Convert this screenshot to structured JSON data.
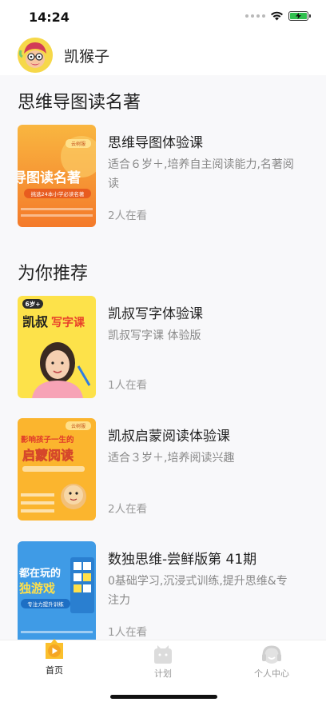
{
  "status_bar": {
    "time": "14:24"
  },
  "header": {
    "username": "凯猴子"
  },
  "sections": [
    {
      "title": "思维导图读名著"
    },
    {
      "title": "为你推荐"
    }
  ],
  "courses": [
    {
      "title": "思维导图体验课",
      "desc": "适合６岁＋,培养自主阅读能力,名著阅读",
      "count": "2人在看",
      "thumb": {
        "tag": "云树服",
        "headline": "导图读名著",
        "sub": "挑选24本小学必读名著"
      }
    },
    {
      "title": "凯叔写字体验课",
      "desc": "凯叔写字课 体验版",
      "count": "1人在看",
      "thumb": {
        "tag": "6岁+",
        "headline": "凯叔",
        "headline_accent": "写字课"
      }
    },
    {
      "title": "凯叔启蒙阅读体验课",
      "desc": "适合３岁＋,培养阅读兴趣",
      "count": "2人在看",
      "thumb": {
        "tag": "云树服",
        "headline": "影响孩子一生的",
        "headline2": "启蒙阅读"
      }
    },
    {
      "title": "数独思维-尝鲜版第 41期",
      "desc": "0基础学习,沉浸式训练,提升思维&专注力",
      "count": "1人在看",
      "thumb": {
        "headline": "都在玩的",
        "headline2": "独游戏",
        "sub": "专注力提升训练"
      }
    }
  ],
  "tabbar": {
    "tabs": [
      {
        "label": "首页",
        "active": true
      },
      {
        "label": "计划",
        "active": false
      },
      {
        "label": "个人中心",
        "active": false
      }
    ],
    "active_color": "#f5a623",
    "inactive_color": "#999999"
  },
  "colors": {
    "accent": "#f5a623"
  }
}
